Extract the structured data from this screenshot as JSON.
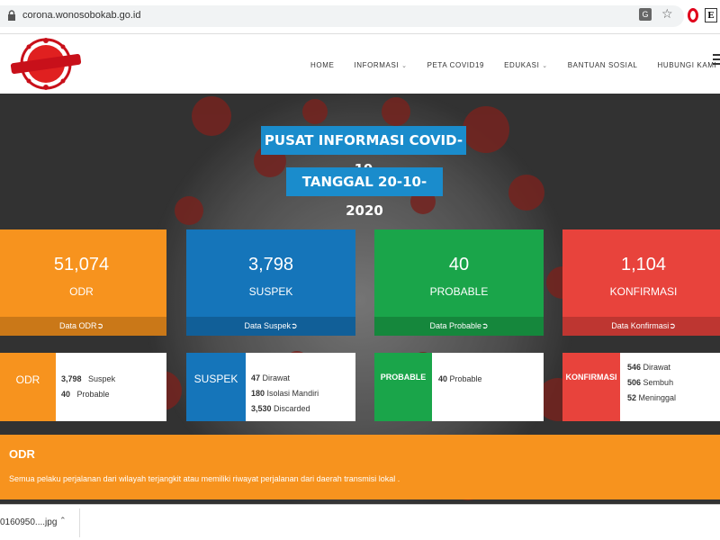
{
  "browser": {
    "url": "corona.wonosobokab.go.id"
  },
  "site": {
    "logo_text": "COVID-19",
    "nav": [
      {
        "label": "HOME",
        "dropdown": false
      },
      {
        "label": "INFORMASI",
        "dropdown": true
      },
      {
        "label": "PETA COVID19",
        "dropdown": false
      },
      {
        "label": "EDUKASI",
        "dropdown": true
      },
      {
        "label": "BANTUAN SOSIAL",
        "dropdown": false
      },
      {
        "label": "HUBUNGI KAMI",
        "dropdown": false
      }
    ]
  },
  "hero": {
    "title": "PUSAT INFORMASI COVID-19",
    "date": "TANGGAL 20-10-2020"
  },
  "cards": {
    "odr": {
      "value": "51,074",
      "label": "ODR",
      "link": "Data ODR",
      "color": "#f7931e"
    },
    "suspek": {
      "value": "3,798",
      "label": "SUSPEK",
      "link": "Data Suspek",
      "color": "#1575ba"
    },
    "probable": {
      "value": "40",
      "label": "PROBABLE",
      "link": "Data Probable",
      "color": "#1aa54a"
    },
    "konfirmasi": {
      "value": "1,104",
      "label": "KONFIRMASI",
      "link": "Data Konfirmasi",
      "color": "#e8433c"
    }
  },
  "details": {
    "odr": {
      "tag": "ODR",
      "rows": [
        {
          "n": "3,798",
          "t": "Suspek"
        },
        {
          "n": "40",
          "t": "Probable"
        }
      ]
    },
    "suspek": {
      "tag": "SUSPEK",
      "rows": [
        {
          "n": "47",
          "t": "Dirawat"
        },
        {
          "n": "180",
          "t": "Isolasi Mandiri"
        },
        {
          "n": "3,530",
          "t": "Discarded"
        }
      ]
    },
    "probable": {
      "tag": "PROBABLE",
      "rows": [
        {
          "n": "40",
          "t": "Probable"
        }
      ]
    },
    "konfirmasi": {
      "tag": "KONFIRMASI",
      "rows": [
        {
          "n": "546",
          "t": "Dirawat"
        },
        {
          "n": "506",
          "t": "Sembuh"
        },
        {
          "n": "52",
          "t": "Meninggal"
        }
      ]
    }
  },
  "odr_info": {
    "heading": "ODR",
    "text": "Semua pelaku perjalanan dari wilayah terjangkit atau memiliki riwayat perjalanan dari daerah transmisi lokal ."
  },
  "download": {
    "filename": "0160950....jpg"
  }
}
